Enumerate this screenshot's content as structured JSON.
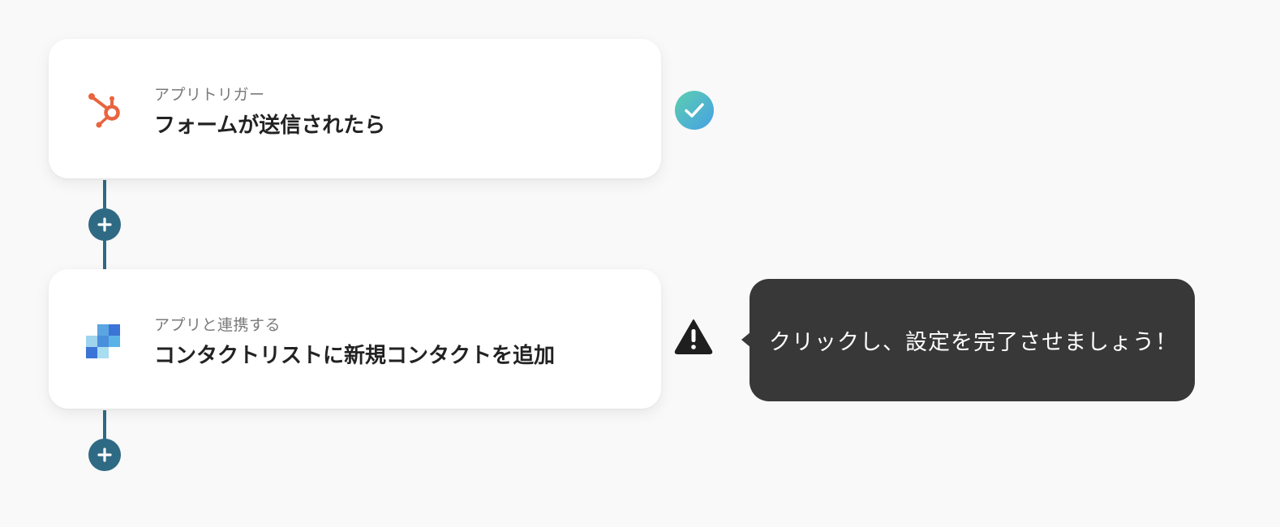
{
  "steps": [
    {
      "type_label": "アプリトリガー",
      "title": "フォームが送信されたら",
      "app_icon": "hubspot-icon",
      "status": "complete",
      "status_icon": "check-circle-icon"
    },
    {
      "type_label": "アプリと連携する",
      "title": "コンタクトリストに新規コンタクトを追加",
      "app_icon": "pixel-squares-app-icon",
      "status": "warning",
      "status_icon": "warning-triangle-icon"
    }
  ],
  "tooltip": {
    "text": "クリックし、設定を完了させましょう！"
  },
  "colors": {
    "background": "#f9f9f9",
    "connector": "#2f6a84",
    "hubspot_orange": "#e9643f",
    "check_gradient_start": "#55cbb8",
    "check_gradient_end": "#4aa3e0",
    "tooltip_bg": "#383838",
    "warning": "#1f1f1f"
  }
}
